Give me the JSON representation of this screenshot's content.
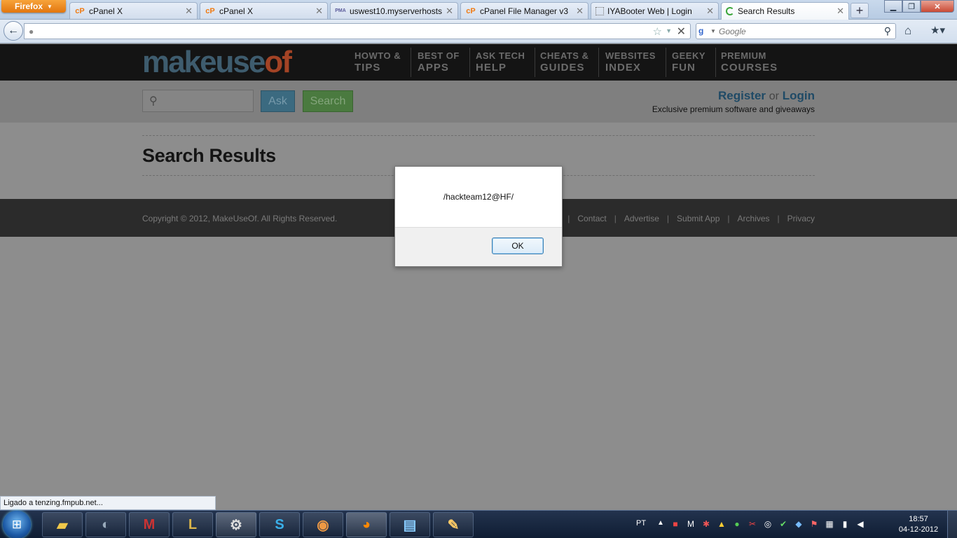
{
  "browser": {
    "menu_label": "Firefox",
    "tabs": [
      {
        "label": "cPanel X",
        "icon": "cpanel-icon"
      },
      {
        "label": "cPanel X",
        "icon": "cpanel-icon"
      },
      {
        "label": "uswest10.myserverhosts....",
        "icon": "phpmyadmin-icon"
      },
      {
        "label": "cPanel File Manager v3",
        "icon": "cpanel-icon"
      },
      {
        "label": "IYABooter Web | Login",
        "icon": "blank-page-icon"
      },
      {
        "label": "Search Results",
        "icon": "loading-icon"
      }
    ],
    "url": "",
    "search_placeholder": "Google",
    "status_text": "Ligado a tenzing.fmpub.net..."
  },
  "site": {
    "logo_part1": "makeuse",
    "logo_part2": "of",
    "nav": [
      {
        "l1": "HOWTO &",
        "l2": "TIPS"
      },
      {
        "l1": "BEST OF",
        "l2": "APPS"
      },
      {
        "l1": "ASK TECH",
        "l2": "HELP"
      },
      {
        "l1": "CHEATS &",
        "l2": "GUIDES"
      },
      {
        "l1": "WEBSITES",
        "l2": "INDEX"
      },
      {
        "l1": "GEEKY",
        "l2": "FUN"
      },
      {
        "l1": "PREMIUM",
        "l2": "COURSES"
      }
    ],
    "search_placeholder": "",
    "ask_label": "Ask",
    "search_label": "Search",
    "register_label": "Register",
    "or_label": "or",
    "login_label": "Login",
    "tagline": "Exclusive premium software and giveaways",
    "results_title": "Search Results",
    "copyright": "Copyright © 2012, MakeUseOf. All Rights Reserved.",
    "footer_partial": "t",
    "footer_links": [
      "Contact",
      "Advertise",
      "Submit App",
      "Archives",
      "Privacy"
    ]
  },
  "alert": {
    "message": "/hackteam12@HF/",
    "ok_label": "OK"
  },
  "taskbar": {
    "apps": [
      "explorer-icon",
      "quicktime-icon",
      "malwarebytes-icon",
      "league-of-legends-icon",
      "steam-icon",
      "skype-icon",
      "chrome-icon",
      "firefox-icon",
      "notepad-icon",
      "paint-icon"
    ],
    "language": "PT",
    "time": "18:57",
    "date": "04-12-2012"
  },
  "colors": {
    "logo_blue": "#3e5c6e",
    "logo_orange": "#a34325",
    "header_bg": "#141414",
    "footer_bg": "#2b2b2b"
  }
}
